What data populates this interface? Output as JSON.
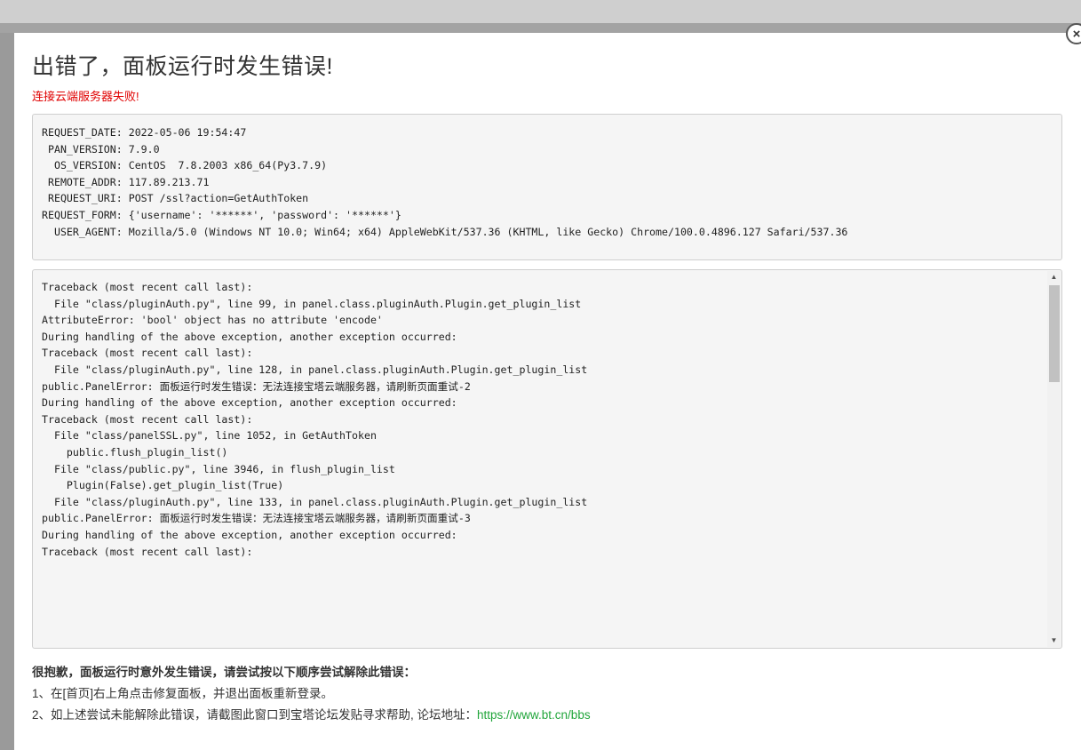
{
  "dialog": {
    "title": "出错了，面板运行时发生错误!",
    "subtitle": "连接云端服务器失败!",
    "close_icon": "×"
  },
  "request_info": [
    "REQUEST_DATE: 2022-05-06 19:54:47",
    " PAN_VERSION: 7.9.0",
    "  OS_VERSION: CentOS  7.8.2003 x86_64(Py3.7.9)",
    " REMOTE_ADDR: 117.89.213.71",
    " REQUEST_URI: POST /ssl?action=GetAuthToken",
    "REQUEST_FORM: {'username': '******', 'password': '******'}",
    "  USER_AGENT: Mozilla/5.0 (Windows NT 10.0; Win64; x64) AppleWebKit/537.36 (KHTML, like Gecko) Chrome/100.0.4896.127 Safari/537.36"
  ],
  "traceback": [
    "Traceback (most recent call last):",
    "  File \"class/pluginAuth.py\", line 99, in panel.class.pluginAuth.Plugin.get_plugin_list",
    "AttributeError: 'bool' object has no attribute 'encode'",
    "",
    "During handling of the above exception, another exception occurred:",
    "",
    "Traceback (most recent call last):",
    "  File \"class/pluginAuth.py\", line 128, in panel.class.pluginAuth.Plugin.get_plugin_list",
    "public.PanelError: 面板运行时发生错误：无法连接宝塔云端服务器，请刷新页面重试-2",
    "",
    "During handling of the above exception, another exception occurred:",
    "",
    "Traceback (most recent call last):",
    "  File \"class/panelSSL.py\", line 1052, in GetAuthToken",
    "    public.flush_plugin_list()",
    "  File \"class/public.py\", line 3946, in flush_plugin_list",
    "    Plugin(False).get_plugin_list(True)",
    "  File \"class/pluginAuth.py\", line 133, in panel.class.pluginAuth.Plugin.get_plugin_list",
    "public.PanelError: 面板运行时发生错误：无法连接宝塔云端服务器，请刷新页面重试-3",
    "",
    "During handling of the above exception, another exception occurred:",
    "",
    "Traceback (most recent call last):"
  ],
  "scrollbar": {
    "up_arrow": "▲",
    "down_arrow": "▼"
  },
  "help": {
    "title": "很抱歉，面板运行时意外发生错误，请尝试按以下顺序尝试解除此错误：",
    "step1": "1、在[首页]右上角点击修复面板，并退出面板重新登录。",
    "step2_text": "2、如上述尝试未能解除此错误，请截图此窗口到宝塔论坛发贴寻求帮助, 论坛地址：",
    "step2_link": "https://www.bt.cn/bbs"
  }
}
